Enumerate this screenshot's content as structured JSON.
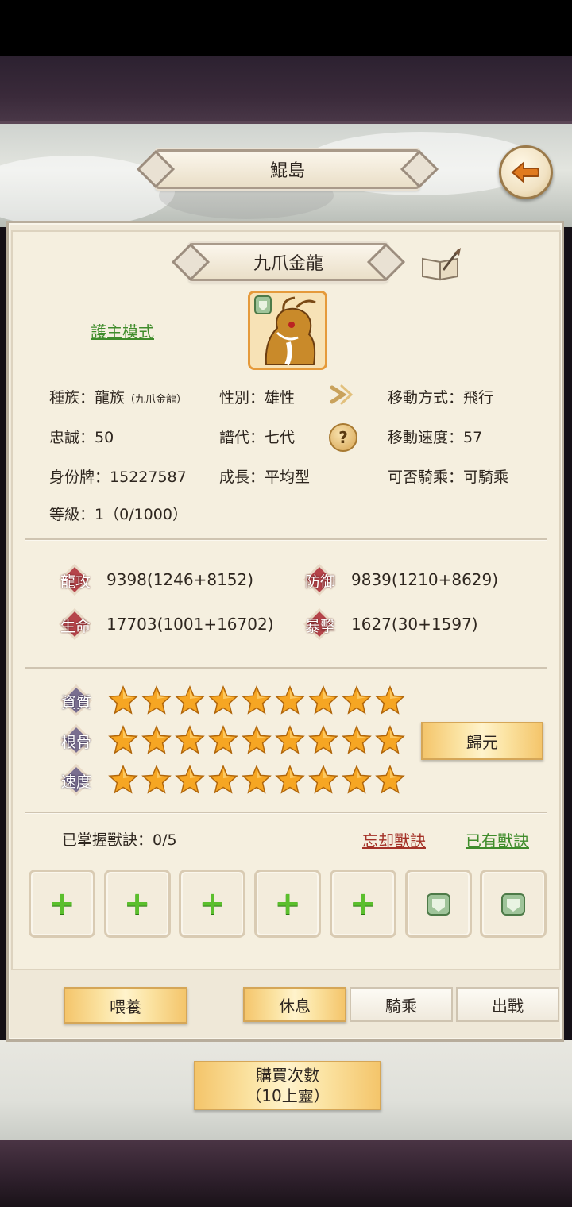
{
  "header": {
    "title": "鯤島"
  },
  "pet": {
    "name": "九爪金龍",
    "guard_mode": "護主模式",
    "info": {
      "race_label": "種族：",
      "race_value": "龍族",
      "race_detail": "（九爪金龍）",
      "gender_label": "性別：",
      "gender_value": "雄性",
      "move_type_label": "移動方式：",
      "move_type_value": "飛行",
      "loyalty_label": "忠誠：",
      "loyalty_value": "50",
      "generation_label": "譜代：",
      "generation_value": "七代",
      "move_speed_label": "移動速度：",
      "move_speed_value": "57",
      "id_label": "身份牌：",
      "id_value": "15227587",
      "growth_label": "成長：",
      "growth_value": "平均型",
      "rideable_label": "可否騎乘：",
      "rideable_value": "可騎乘",
      "level_label": "等級：",
      "level_value": "1（0/1000）"
    },
    "stats": [
      {
        "label": "龍攻",
        "value": "9398(1246+8152)"
      },
      {
        "label": "防御",
        "value": "9839(1210+8629)"
      },
      {
        "label": "生命",
        "value": "17703(1001+16702)"
      },
      {
        "label": "暴擊",
        "value": "1627(30+1597)"
      }
    ],
    "ratings": [
      {
        "label": "資質",
        "stars": 9
      },
      {
        "label": "根骨",
        "stars": 9
      },
      {
        "label": "速度",
        "stars": 9
      }
    ],
    "reset_button": "歸元",
    "skills": {
      "mastered_label": "已掌握獸訣：",
      "mastered_value": "0/5",
      "forget_link": "忘却獸訣",
      "owned_link": "已有獸訣",
      "slots": [
        "add",
        "add",
        "add",
        "add",
        "add",
        "locked",
        "locked"
      ]
    }
  },
  "actions": {
    "feed": "喂養",
    "rest": "休息",
    "ride": "騎乘",
    "battle": "出戰",
    "buy_line1": "購買次數",
    "buy_line2": "（10上靈）"
  },
  "colors": {
    "accent_gold": "#f4c56b",
    "link_green": "#3f8c2b",
    "link_red": "#a43228",
    "star": "#f6a623"
  }
}
